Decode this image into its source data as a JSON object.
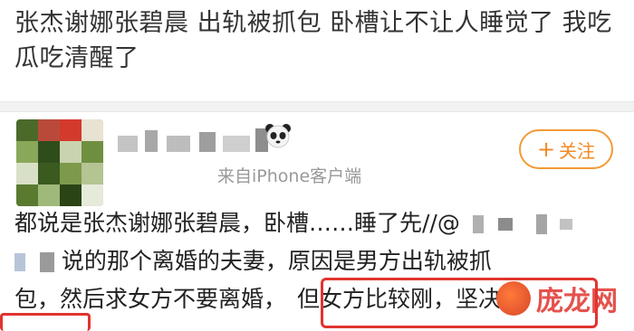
{
  "post": {
    "line1": "张杰谢娜张碧晨 出轨被抓包 卧槽让不让人睡觉了 我吃",
    "line2": "瓜吃清醒了"
  },
  "comment": {
    "source": "来自iPhone客户端",
    "follow_label": "关注",
    "follow_plus": "+",
    "line1": "都说是张杰谢娜张碧晨，卧槽……睡了先//@",
    "line2": "说的那个离婚的夫妻，原因是男方出轨被抓",
    "line3_a": "包，然后求女方不要离婚，",
    "line3_b": "但女方比较刚，坚决离"
  },
  "watermark": {
    "text": "庞龙网"
  },
  "colors": {
    "accent_orange": "#f08a24",
    "highlight_red": "#e0342f",
    "source_gray": "#999999"
  },
  "icons": {
    "avatar": "pixelated-avatar",
    "panda": "panda-emoji-icon",
    "watermark_logo": "watermark-logo-icon"
  }
}
